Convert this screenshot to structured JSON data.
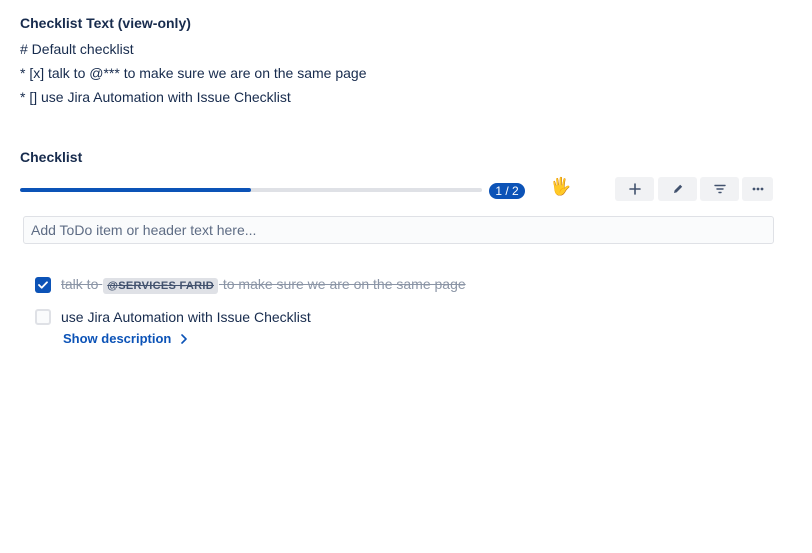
{
  "view_section": {
    "title": "Checklist Text (view-only)",
    "lines": [
      "# Default checklist",
      "* [x] talk to @*** to make sure we are on the same page",
      "* [] use Jira Automation with Issue Checklist"
    ]
  },
  "checklist": {
    "title": "Checklist",
    "progress": {
      "completed_fraction": 0.5,
      "label": "1 / 2",
      "emoji": "🖐"
    },
    "toolbar": {
      "add_icon": "plus-icon",
      "edit_icon": "pencil-icon",
      "filter_icon": "filter-icon",
      "more_icon": "ellipsis-icon"
    },
    "input": {
      "placeholder": "Add ToDo item or header text here...",
      "value": ""
    },
    "items": [
      {
        "checked": true,
        "text_before": "talk to",
        "mention": "@SERVICES FARID",
        "text_after": "to make sure we are on the same page"
      },
      {
        "checked": false,
        "text": "use Jira Automation with Issue Checklist",
        "show_description": "Show description"
      }
    ]
  },
  "colors": {
    "primary": "#0c53b7",
    "text": "#172b4d",
    "muted": "#8b95a6",
    "track": "#dfe1e6"
  }
}
